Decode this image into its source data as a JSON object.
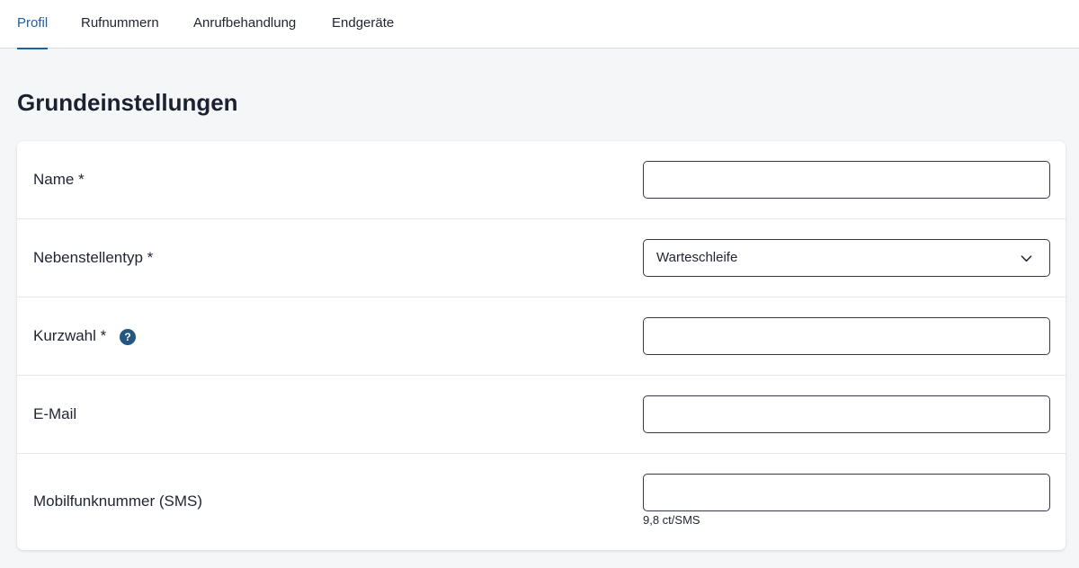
{
  "tabs": [
    {
      "label": "Profil",
      "active": true
    },
    {
      "label": "Rufnummern",
      "active": false
    },
    {
      "label": "Anrufbehandlung",
      "active": false
    },
    {
      "label": "Endgeräte",
      "active": false
    }
  ],
  "section": {
    "title": "Grundeinstellungen"
  },
  "fields": {
    "name": {
      "label": "Name *",
      "value": ""
    },
    "nebenstellentyp": {
      "label": "Nebenstellentyp *",
      "selected": "Warteschleife"
    },
    "kurzwahl": {
      "label": "Kurzwahl *",
      "help_icon": "question-circle-icon",
      "help_glyph": "?",
      "value": ""
    },
    "email": {
      "label": "E-Mail",
      "value": ""
    },
    "mobilfunk": {
      "label": "Mobilfunknummer (SMS)",
      "value": "",
      "hint": "9,8 ct/SMS"
    }
  },
  "colors": {
    "accent": "#1d5f9f",
    "page_background": "#f5f6f8",
    "card_background": "#ffffff",
    "text": "#1f2430",
    "help_icon": "#24577f",
    "input_border": "#343944"
  }
}
